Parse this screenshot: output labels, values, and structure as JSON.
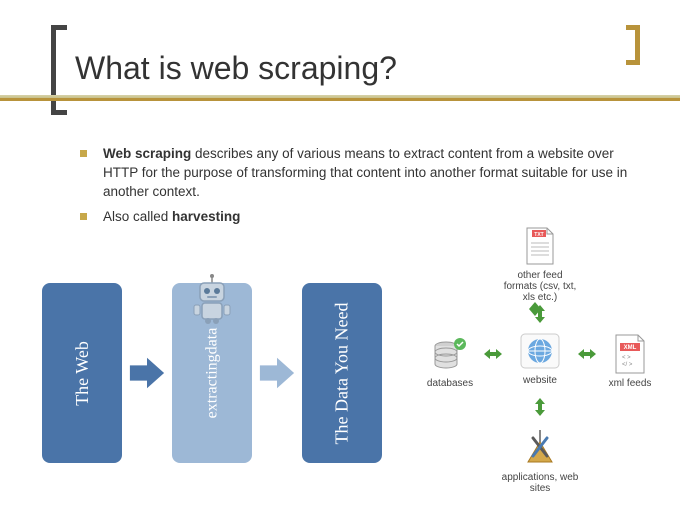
{
  "title": "What is web scraping?",
  "bullets": [
    {
      "bold_lead": "Web scraping",
      "rest": " describes any of various means to extract content from a website over HTTP for the purpose of transforming that content into another format suitable for use in another context."
    },
    {
      "plain_lead": "Also called ",
      "bold_tail": "harvesting"
    }
  ],
  "flow": {
    "box1": "The Web",
    "box2": "extractingdata",
    "box3": "The Data You Need"
  },
  "diagram": {
    "top": "other feed formats (csv, txt, xls etc.)",
    "left": "databases",
    "center": "website",
    "right": "xml feeds",
    "bottom": "applications, web sites",
    "xml_badge": "XML",
    "txt_badge": "TXT"
  }
}
